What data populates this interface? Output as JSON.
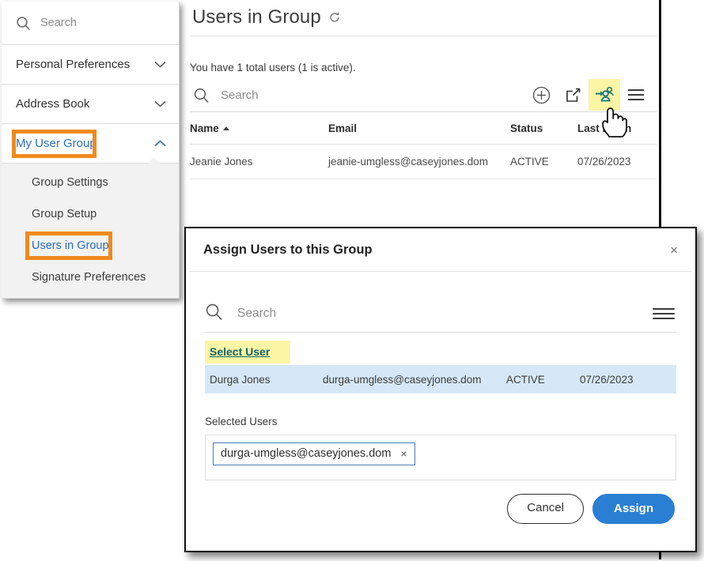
{
  "sidebar": {
    "search": {
      "placeholder": "Search",
      "icon": "search-icon"
    },
    "items": [
      {
        "label": "Personal Preferences",
        "state": "collapsed",
        "icon": "chevron-down-icon"
      },
      {
        "label": "Address Book",
        "state": "collapsed",
        "icon": "chevron-down-icon"
      },
      {
        "label": "My User Group",
        "state": "expanded",
        "icon": "chevron-up-icon",
        "highlighted": true
      }
    ],
    "submenu": [
      {
        "label": "Group Settings",
        "selected": false
      },
      {
        "label": "Group Setup",
        "selected": false
      },
      {
        "label": "Users in Group",
        "selected": true,
        "highlighted": true
      },
      {
        "label": "Signature Preferences",
        "selected": false
      }
    ],
    "callout_color": "#f08a1d"
  },
  "main": {
    "page_title": "Users in Group",
    "refresh_icon": "refresh-icon",
    "summary": "You have 1 total users (1 is active).",
    "toolbar": {
      "search_placeholder": "Search",
      "search_icon": "search-icon",
      "icons": [
        {
          "name": "add-circle-icon",
          "highlighted": false
        },
        {
          "name": "share-export-icon",
          "highlighted": false
        },
        {
          "name": "assign-users-icon",
          "highlighted": true,
          "color": "#1b7a6e"
        },
        {
          "name": "hamburger-menu-icon",
          "highlighted": false
        }
      ],
      "highlight_color": "#fbf5a5"
    },
    "table": {
      "columns": [
        "Name",
        "Email",
        "Status",
        "Last Login"
      ],
      "sort_column": "Name",
      "sort_direction": "asc",
      "rows": [
        {
          "name": "Jeanie Jones",
          "email": "jeanie-umgless@caseyjones.dom",
          "status": "ACTIVE",
          "last_login": "07/26/2023"
        }
      ]
    },
    "cursor": "pointing-hand-cursor"
  },
  "modal": {
    "title": "Assign Users to this Group",
    "close_label": "×",
    "search_placeholder": "Search",
    "search_icon": "search-icon",
    "menu_icon": "hamburger-menu-icon",
    "select_user_link": "Select User",
    "select_user_highlight": "#fbf5a5",
    "select_user_color": "#136464",
    "result_row": {
      "name": "Durga Jones",
      "email": "durga-umgless@caseyjones.dom",
      "status": "ACTIVE",
      "last_login": "07/26/2023",
      "row_background": "#d6e8f7"
    },
    "selected_users_label": "Selected Users",
    "chips": [
      {
        "label": "durga-umgless@caseyjones.dom",
        "remove_label": "×"
      }
    ],
    "buttons": {
      "cancel": "Cancel",
      "assign": "Assign",
      "assign_color": "#2a7fd4"
    }
  }
}
